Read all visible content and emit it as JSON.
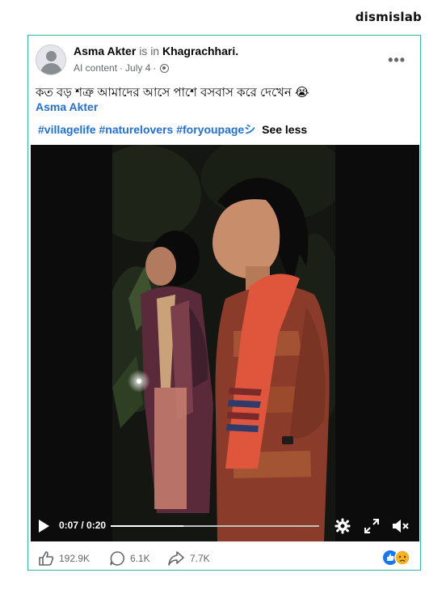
{
  "brand": "dismislab",
  "post": {
    "author": "Asma Akter",
    "is_in": "is in",
    "location": "Khagrachhari.",
    "ai_label": "AI content",
    "date": "July 4",
    "separator": "·",
    "more_label": "•••",
    "caption": "কত বড় শত্রু আমাদের আসে পাশে বসবাস করে দেখেন 😭",
    "mention": "Asma Akter",
    "hashtags": [
      "#villagelife",
      "#naturelovers",
      "#foryoupageシ"
    ],
    "see_less": "See less"
  },
  "video": {
    "current_time": "0:07",
    "duration": "0:20",
    "time_display": "0:07 / 0:20",
    "progress": 0.35
  },
  "stats": {
    "likes": "192.9K",
    "comments": "6.1K",
    "shares": "7.7K"
  },
  "colors": {
    "border": "#2fb9a4",
    "link": "#216fdb",
    "like_blue": "#1877f2",
    "sad_yellow": "#f7b125"
  },
  "icons": {
    "like": "thumbs-up-icon",
    "comment": "comment-bubble-icon",
    "share": "share-arrow-icon",
    "settings": "gear-icon",
    "fullscreen": "expand-icon",
    "volume": "volume-muted-icon",
    "play": "play-icon",
    "privacy": "globe-icon"
  }
}
